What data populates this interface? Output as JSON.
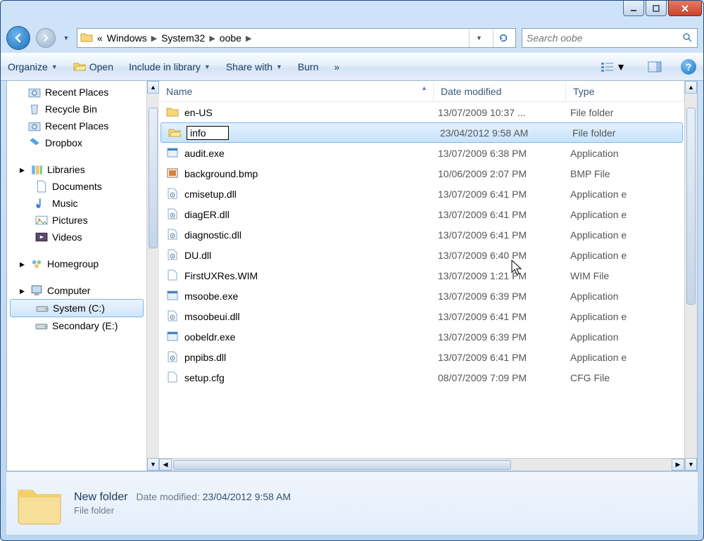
{
  "breadcrumbs": {
    "root_prefix": "«",
    "items": [
      "Windows",
      "System32",
      "oobe"
    ]
  },
  "search": {
    "placeholder": "Search oobe"
  },
  "toolbar": {
    "organize": "Organize",
    "open": "Open",
    "include": "Include in library",
    "share": "Share with",
    "burn": "Burn",
    "overflow": "»"
  },
  "columns": {
    "name": "Name",
    "date": "Date modified",
    "type": "Type"
  },
  "navpane": {
    "favorites_block": [
      {
        "label": "Recent Places",
        "icon": "recent"
      },
      {
        "label": "Recycle Bin",
        "icon": "recycle"
      },
      {
        "label": "Recent Places",
        "icon": "recent"
      },
      {
        "label": "Dropbox",
        "icon": "dropbox"
      }
    ],
    "libraries": {
      "label": "Libraries",
      "items": [
        "Documents",
        "Music",
        "Pictures",
        "Videos"
      ]
    },
    "homegroup": "Homegroup",
    "computer": {
      "label": "Computer",
      "drives": [
        {
          "label": "System (C:)",
          "selected": true
        },
        {
          "label": "Secondary (E:)",
          "selected": false
        }
      ]
    }
  },
  "files": [
    {
      "name": "en-US",
      "date": "13/07/2009 10:37 ...",
      "type": "File folder",
      "icon": "folder"
    },
    {
      "name": "info",
      "date": "23/04/2012 9:58 AM",
      "type": "File folder",
      "icon": "folderopen",
      "selected": true,
      "renaming": true
    },
    {
      "name": "audit.exe",
      "date": "13/07/2009 6:38 PM",
      "type": "Application",
      "icon": "exe"
    },
    {
      "name": "background.bmp",
      "date": "10/06/2009 2:07 PM",
      "type": "BMP File",
      "icon": "bmp"
    },
    {
      "name": "cmisetup.dll",
      "date": "13/07/2009 6:41 PM",
      "type": "Application e",
      "icon": "dll"
    },
    {
      "name": "diagER.dll",
      "date": "13/07/2009 6:41 PM",
      "type": "Application e",
      "icon": "dll"
    },
    {
      "name": "diagnostic.dll",
      "date": "13/07/2009 6:41 PM",
      "type": "Application e",
      "icon": "dll"
    },
    {
      "name": "DU.dll",
      "date": "13/07/2009 6:40 PM",
      "type": "Application e",
      "icon": "dll"
    },
    {
      "name": "FirstUXRes.WIM",
      "date": "13/07/2009 1:21 PM",
      "type": "WIM File",
      "icon": "file"
    },
    {
      "name": "msoobe.exe",
      "date": "13/07/2009 6:39 PM",
      "type": "Application",
      "icon": "exe"
    },
    {
      "name": "msoobeui.dll",
      "date": "13/07/2009 6:41 PM",
      "type": "Application e",
      "icon": "dll"
    },
    {
      "name": "oobeldr.exe",
      "date": "13/07/2009 6:39 PM",
      "type": "Application",
      "icon": "exe"
    },
    {
      "name": "pnpibs.dll",
      "date": "13/07/2009 6:41 PM",
      "type": "Application e",
      "icon": "dll"
    },
    {
      "name": "setup.cfg",
      "date": "08/07/2009 7:09 PM",
      "type": "CFG File",
      "icon": "file"
    }
  ],
  "details": {
    "name": "New folder",
    "type": "File folder",
    "modified_label": "Date modified:",
    "modified_value": "23/04/2012 9:58 AM"
  }
}
